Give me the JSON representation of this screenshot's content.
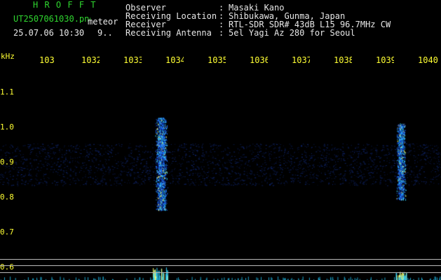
{
  "header": {
    "logo": "H R O F F T",
    "filename": "UT2507061030.png",
    "type_label": "meteor",
    "datetime": "25.07.06 10:30",
    "count": "9.."
  },
  "info": {
    "rows": [
      {
        "label": "Observer",
        "value": "Masaki Kano"
      },
      {
        "label": "Receiving Location",
        "value": "Shibukawa, Gunma, Japan"
      },
      {
        "label": "Receiver",
        "value": "RTL-SDR SDR# 43dB L15 96.7MHz CW"
      },
      {
        "label": "Receiving Antenna",
        "value": "5el Yagi Az 280 for Seoul"
      }
    ]
  },
  "frequency_axis": {
    "ticks": [
      "103",
      "1032",
      "1033",
      "1034",
      "1035",
      "1036",
      "1037",
      "1038",
      "1039",
      "1040"
    ]
  },
  "y_axis": {
    "unit": "kHz",
    "ticks": [
      "1.1",
      "1.0",
      "0.9",
      "0.8",
      "0.7",
      "0.6"
    ]
  },
  "colors": {
    "background": "#000000",
    "noise": "#0b1f6e",
    "signal_core": "#36d6ff",
    "signal_peak": "#ffff66",
    "header_green": "#2fd62f",
    "axis_yellow": "#ffff33"
  }
}
